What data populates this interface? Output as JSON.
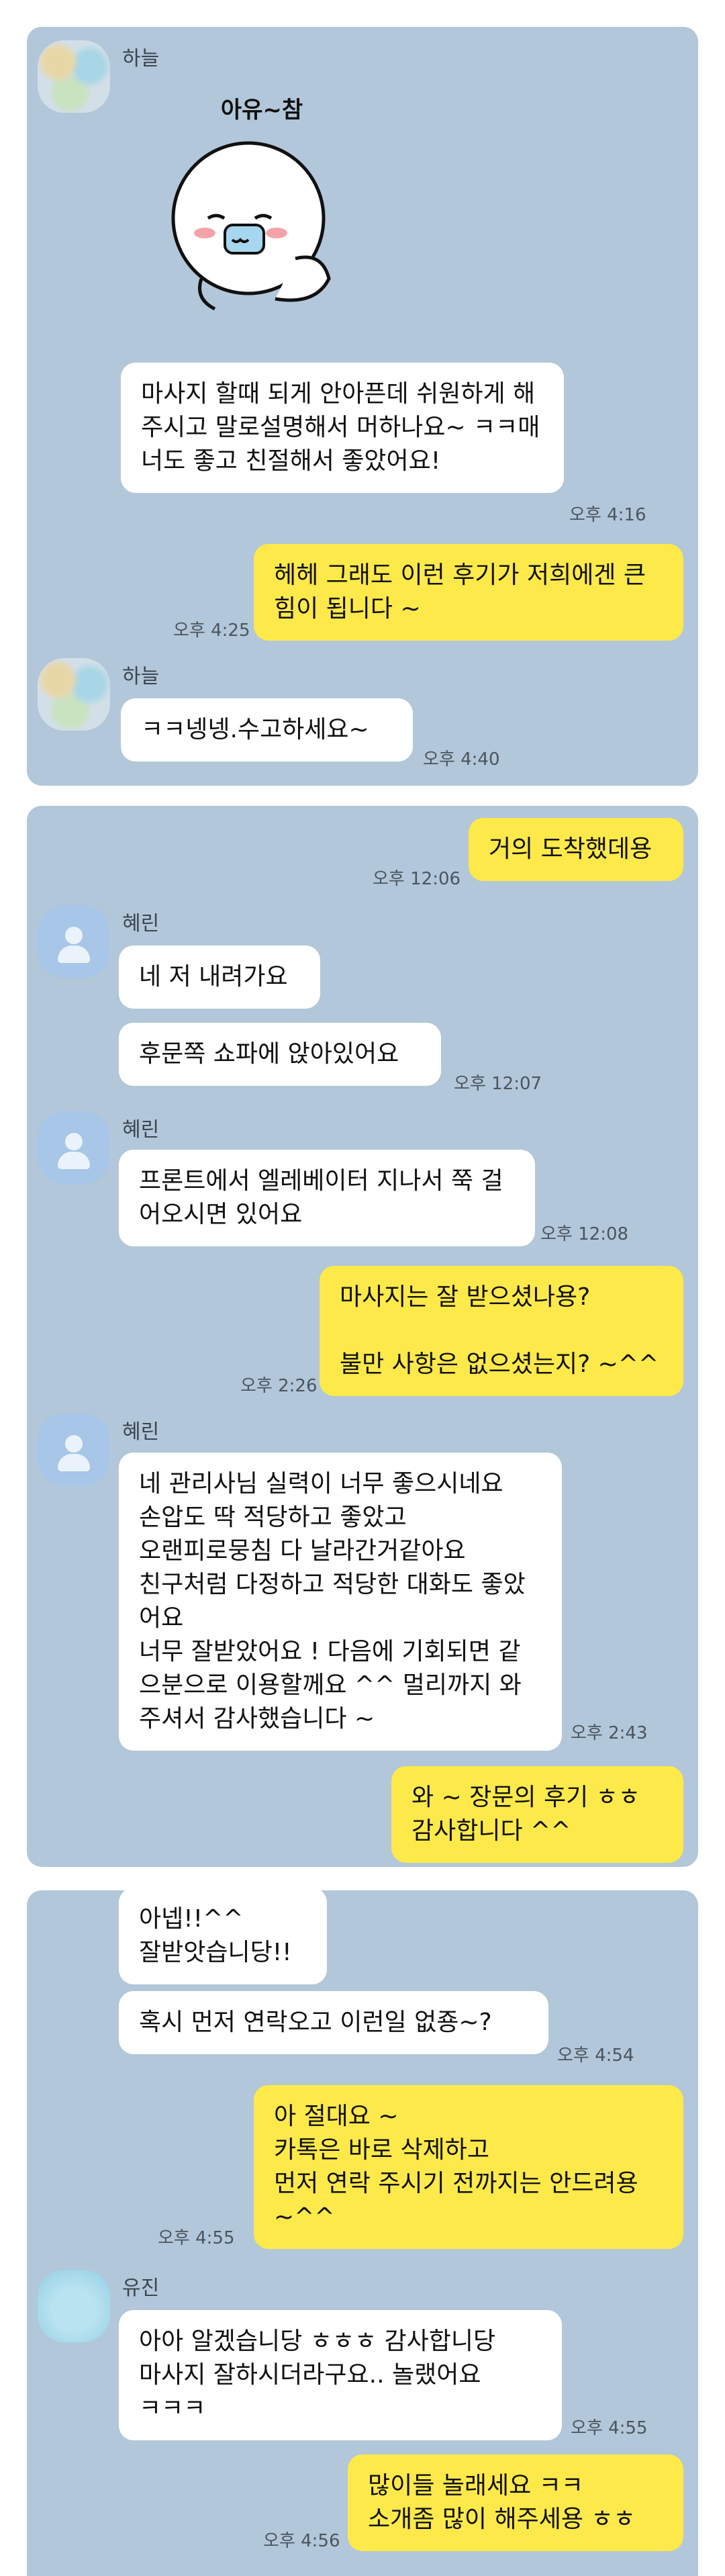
{
  "panels": [
    {
      "messages": [
        {
          "sender": "하늘",
          "sticker_text": "아유~참"
        },
        {
          "text": "마사지 할때 되게 안아픈데 쉬원하게 해주시고 말로설명해서 머하나요~ ㅋㅋ매너도 좋고 친절해서 좋았어요!",
          "time": "오후 4:16"
        },
        {
          "text": "헤헤 그래도 이런 후기가 저희에겐 큰 힘이 됩니다 ~",
          "time": "오후 4:25"
        },
        {
          "sender": "하늘",
          "text": "ㅋㅋ넹넹.수고하세요~",
          "time": "오후 4:40"
        }
      ]
    },
    {
      "messages": [
        {
          "text": "거의 도착했데용",
          "time": "오후 12:06"
        },
        {
          "sender": "혜린",
          "text": "네 저 내려가요"
        },
        {
          "text": "후문쪽 쇼파에 앉아있어요",
          "time": "오후 12:07"
        },
        {
          "sender": "혜린",
          "text": "프론트에서 엘레베이터 지나서 쭉 걸어오시면 있어요",
          "time": "오후 12:08"
        },
        {
          "text": "마사지는 잘 받으셨나용?\n\n불만 사항은 없으셨는지? ~^^",
          "time": "오후 2:26"
        },
        {
          "sender": "혜린",
          "text": "네 관리사님 실력이 너무 좋으시네요\n손압도 딱 적당하고 좋았고\n오랜피로뭉침 다 날라간거같아요\n친구처럼 다정하고 적당한 대화도 좋았어요\n너무 잘받았어요 ! 다음에 기회되면 같으분으로 이용할께요 ^^ 멀리까지 와주셔서 감사했습니다 ~",
          "time": "오후 2:43"
        },
        {
          "text": "와 ~ 장문의 후기 ㅎㅎ\n감사합니다 ^^"
        }
      ]
    },
    {
      "messages": [
        {
          "text": "아넵!!^^\n잘받앗습니당!!"
        },
        {
          "text": "혹시 먼저 연락오고 이런일 없죵~?",
          "time": "오후 4:54"
        },
        {
          "text": "아 절대요 ~\n카톡은 바로 삭제하고\n먼저 연락 주시기 전까지는 안드려용 ~^^",
          "time": "오후 4:55"
        },
        {
          "sender": "유진",
          "text": "아아 알겠습니당 ㅎㅎㅎ 감사합니당\n마사지 잘하시더라구요.. 놀랬어요\nㅋㅋㅋ",
          "time": "오후 4:55"
        },
        {
          "text": "많이들 놀래세요 ㅋㅋ\n소개좀 많이 해주세용 ㅎㅎ",
          "time": "오후 4:56"
        }
      ]
    }
  ],
  "colors": {
    "background": "#b2c7d9",
    "incoming": "#ffffff",
    "outgoing": "#fde94a"
  }
}
